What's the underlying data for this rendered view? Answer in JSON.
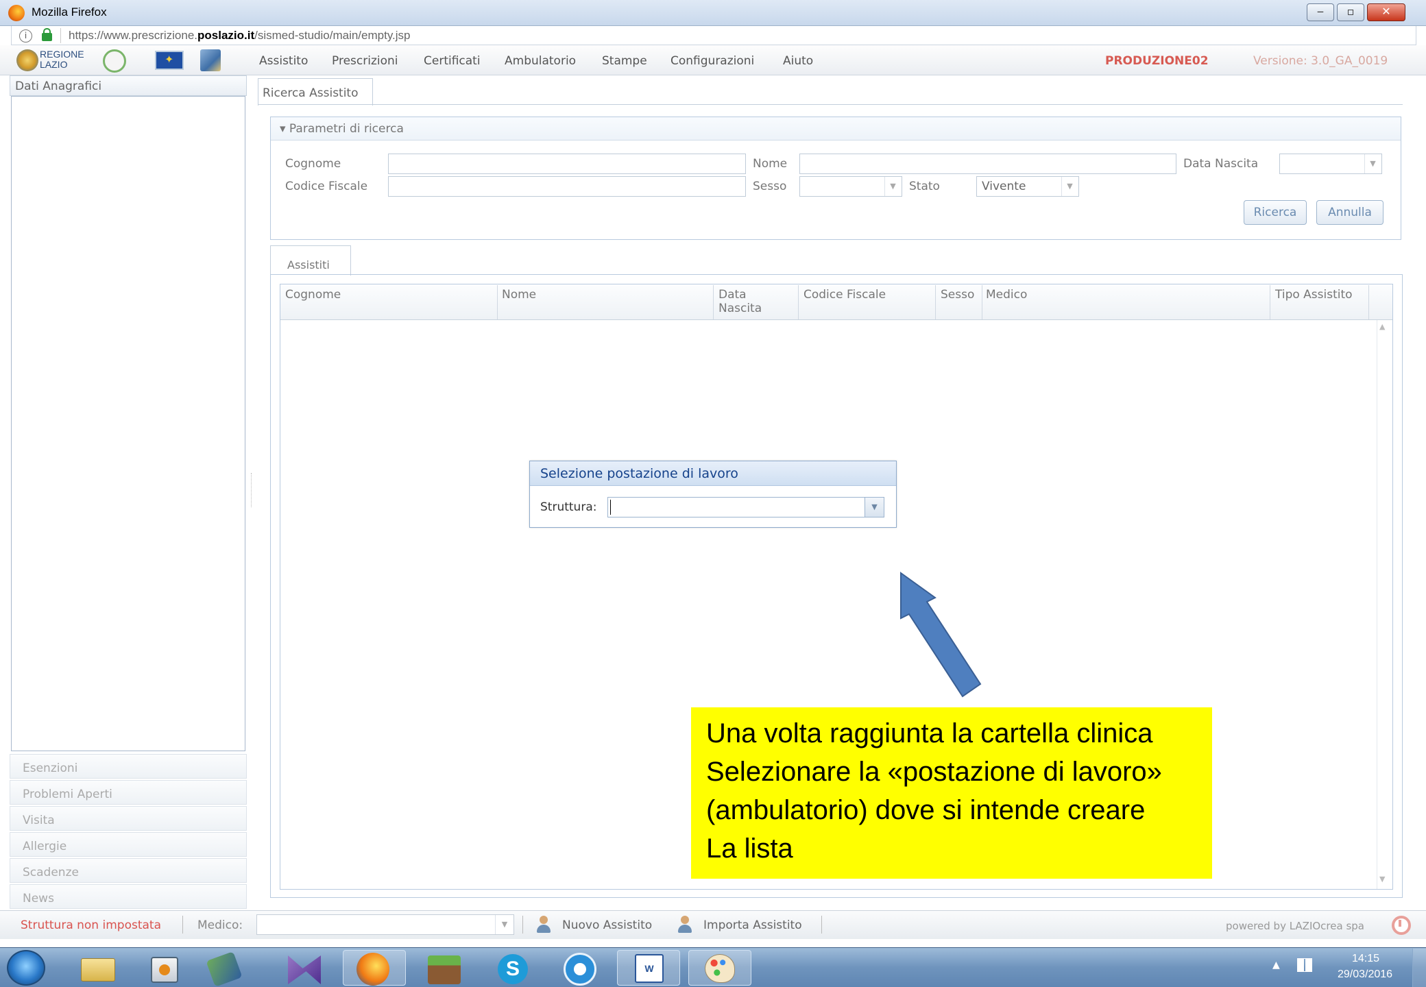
{
  "window": {
    "title": "Mozilla Firefox"
  },
  "browser": {
    "url_prefix": "https://www.prescrizione.",
    "url_domain": "poslazio.it",
    "url_path": "/sismed-studio/main/empty.jsp"
  },
  "appbar": {
    "logo_text_line1": "REGIONE",
    "logo_text_line2": "LAZIO",
    "menu": [
      "Assistito",
      "Prescrizioni",
      "Certificati",
      "Ambulatorio",
      "Stampe",
      "Configurazioni",
      "Aiuto"
    ],
    "environment": "PRODUZIONE02",
    "version": "Versione: 3.0_GA_0019"
  },
  "sidebar": {
    "title": "Dati Anagrafici",
    "items": [
      "Esenzioni",
      "Problemi Aperti",
      "Visita",
      "Allergie",
      "Scadenze",
      "News"
    ]
  },
  "main": {
    "tab": "Ricerca Assistito",
    "params": {
      "title": "▾ Parametri di ricerca",
      "cognome_label": "Cognome",
      "nome_label": "Nome",
      "data_nascita_label": "Data Nascita",
      "codice_fiscale_label": "Codice Fiscale",
      "sesso_label": "Sesso",
      "stato_label": "Stato",
      "stato_value": "Vivente",
      "ricerca_button": "Ricerca",
      "annulla_button": "Annulla"
    },
    "assistiti": {
      "tab": "Assistiti",
      "columns": [
        "Cognome",
        "Nome",
        "Data\nNascita",
        "Codice Fiscale",
        "Sesso",
        "Medico",
        "Tipo Assistito"
      ]
    }
  },
  "dialog": {
    "title": "Selezione postazione di lavoro",
    "struttura_label": "Struttura:",
    "struttura_value": ""
  },
  "annotation": {
    "lines": [
      "Una volta raggiunta la cartella clinica",
      "Selezionare la «postazione di lavoro»",
      "(ambulatorio) dove si intende creare",
      "La lista"
    ],
    "box_color": "#ffff00",
    "arrow_color": "#4f7fbf"
  },
  "statusbar": {
    "struttura": "Struttura non impostata",
    "medico_label": "Medico:",
    "nuovo": "Nuovo Assistito",
    "importa": "Importa Assistito",
    "powered": "powered by LAZIOcrea spa"
  },
  "taskbar": {
    "time": "14:15",
    "date": "29/03/2016",
    "skype_letter": "S",
    "word_letter": "W"
  }
}
